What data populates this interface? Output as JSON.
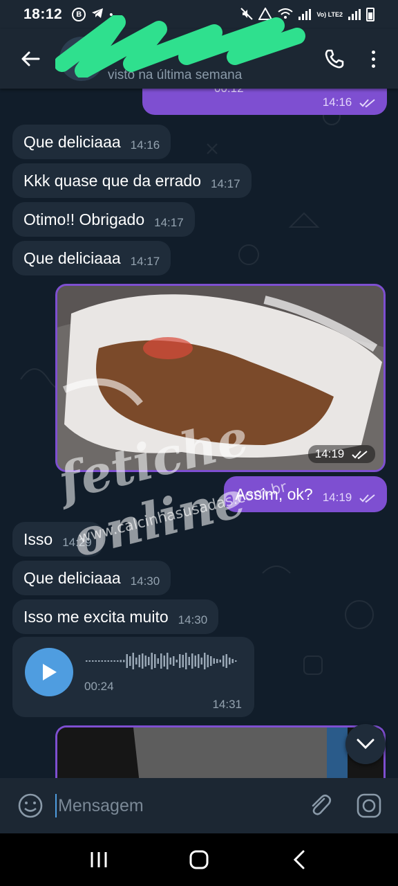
{
  "status_bar": {
    "time": "18:12",
    "network": "Vo) LTE2"
  },
  "header": {
    "contact_status": "visto na última semana"
  },
  "messages": [
    {
      "text": "Que deliciaaa",
      "time": "14:16"
    },
    {
      "text": "Kkk quase que da errado",
      "time": "14:17"
    },
    {
      "text": "Otimo!! Obrigado",
      "time": "14:17"
    },
    {
      "text": "Que deliciaaa",
      "time": "14:17"
    },
    {
      "text": "Assim, ok?",
      "time": "14:19"
    },
    {
      "text": "Isso",
      "time": "14:29"
    },
    {
      "text": "Que deliciaaa",
      "time": "14:30"
    },
    {
      "text": "Isso me excita muito",
      "time": "14:30"
    }
  ],
  "top_partial": {
    "duration": "00:12",
    "time": "14:16"
  },
  "photo": {
    "time": "14:19"
  },
  "voice": {
    "duration": "00:24",
    "time": "14:31"
  },
  "watermark": {
    "brand": "fetiche online",
    "site": "www.calcinhasusadas.com.br"
  },
  "input": {
    "placeholder": "Mensagem"
  },
  "colors": {
    "outgoing": "#7e4fd1",
    "incoming": "#1f2c3a",
    "accent": "#4f9de0"
  }
}
